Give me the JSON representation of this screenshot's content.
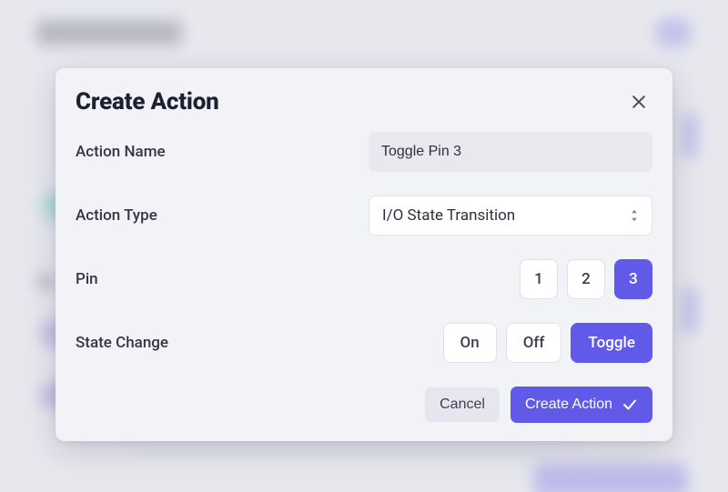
{
  "modal": {
    "title": "Create Action",
    "fields": {
      "name": {
        "label": "Action Name",
        "value": "Toggle Pin 3"
      },
      "type": {
        "label": "Action Type",
        "value": "I/O State Transition"
      },
      "pin": {
        "label": "Pin",
        "options": [
          "1",
          "2",
          "3"
        ],
        "selected": "3"
      },
      "state": {
        "label": "State Change",
        "options": [
          "On",
          "Off",
          "Toggle"
        ],
        "selected": "Toggle"
      }
    },
    "buttons": {
      "cancel": "Cancel",
      "submit": "Create Action"
    }
  },
  "colors": {
    "accent": "#615ae8",
    "text": "#1d1f33",
    "surface": "#f2f3f6"
  }
}
